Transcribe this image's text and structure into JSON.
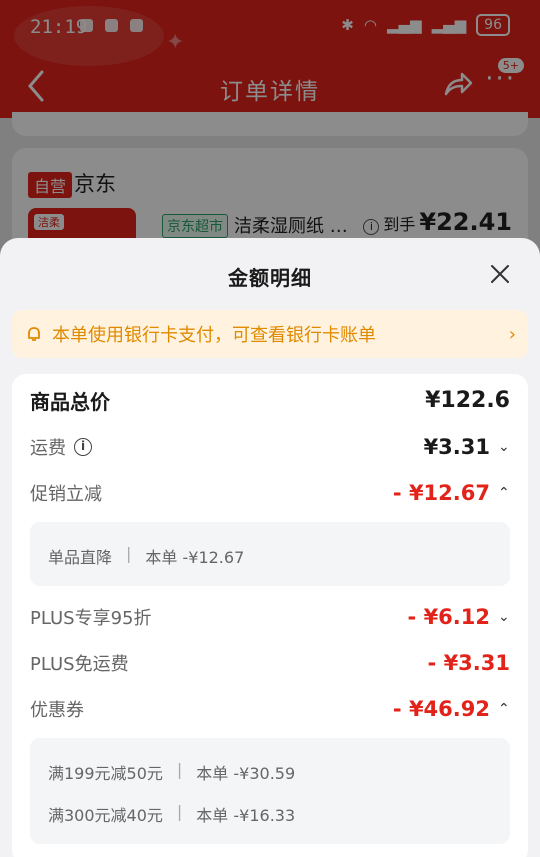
{
  "status_bar": {
    "time": "21:19",
    "battery": "96"
  },
  "nav": {
    "title": "订单详情",
    "more_badge": "5+"
  },
  "background": {
    "self_operated_tag": "自营",
    "store_name": "京东",
    "thumb_label": "洁柔",
    "supermarket_tag": "京东超市",
    "product_name": "洁柔湿厕纸 …",
    "arrival_label": "到手",
    "arrival_price": "¥22.41"
  },
  "sheet": {
    "title": "金额明细",
    "notice": "本单使用银行卡支付，可查看银行卡账单",
    "rows": {
      "total": {
        "label": "商品总价",
        "value": "¥122.6"
      },
      "shipping": {
        "label": "运费",
        "value": "¥3.31"
      },
      "promo": {
        "label": "促销立减",
        "value": "- ¥12.67"
      },
      "promo_detail": {
        "name": "单品直降",
        "sep": "|",
        "amount": "本单 -¥12.67"
      },
      "plus95": {
        "label": "PLUS专享95折",
        "value": "- ¥6.12"
      },
      "plus_ship": {
        "label": "PLUS免运费",
        "value": "- ¥3.31"
      },
      "coupon": {
        "label": "优惠券",
        "value": "- ¥46.92"
      },
      "coupon_detail": [
        {
          "name": "满199元减50元",
          "sep": "|",
          "amount": "本单 -¥30.59"
        },
        {
          "name": "满300元减40元",
          "sep": "|",
          "amount": "本单 -¥16.33"
        }
      ]
    }
  },
  "colors": {
    "brand_red": "#e2231a",
    "notice_orange": "#e08a00",
    "notice_bg": "#fff3df"
  }
}
